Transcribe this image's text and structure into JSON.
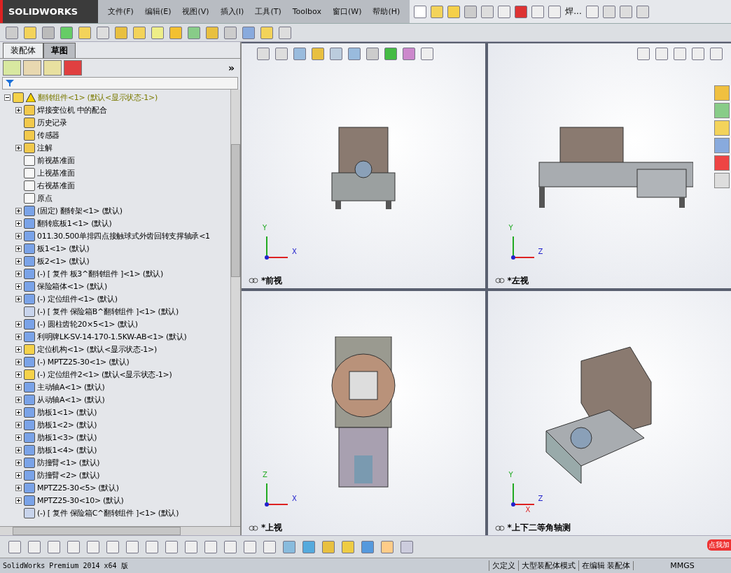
{
  "app": {
    "logo": "SOLIDWORKS",
    "menu": [
      "文件(F)",
      "编辑(E)",
      "视图(V)",
      "插入(I)",
      "工具(T)",
      "Toolbox",
      "窗口(W)",
      "帮助(H)"
    ],
    "weld_button": "焊..."
  },
  "panel": {
    "tabs": [
      {
        "label": "装配体",
        "selected": true
      },
      {
        "label": "草图",
        "selected": false
      }
    ],
    "more": "»"
  },
  "tree": {
    "label": "翻转组件<1> (默认<显示状态-1>)",
    "expanded": true,
    "warning": true,
    "children": [
      {
        "label": "焊接变位机 中的配合",
        "kind": "mates",
        "collapsed": true
      },
      {
        "label": "历史记录",
        "kind": "history",
        "collapsed": false
      },
      {
        "label": "传感器",
        "kind": "sensor",
        "collapsed": false
      },
      {
        "label": "注解",
        "kind": "annotation",
        "collapsed": true
      },
      {
        "label": "前视基准面",
        "kind": "plane",
        "collapsed": false
      },
      {
        "label": "上视基准面",
        "kind": "plane",
        "collapsed": false
      },
      {
        "label": "右视基准面",
        "kind": "plane",
        "collapsed": false
      },
      {
        "label": "原点",
        "kind": "origin",
        "collapsed": false
      },
      {
        "label": "(固定) 翻转架<1> (默认)",
        "kind": "part",
        "collapsed": true
      },
      {
        "label": "翻转底板1<1> (默认)",
        "kind": "part",
        "collapsed": true
      },
      {
        "label": "011.30.500单排四点接触球式外齿回转支撑轴承<1",
        "kind": "part",
        "collapsed": true
      },
      {
        "label": "板1<1> (默认)",
        "kind": "part",
        "collapsed": true
      },
      {
        "label": "板2<1> (默认)",
        "kind": "part",
        "collapsed": true
      },
      {
        "label": "(-) [ 复件 板3^翻转组件 ]<1> (默认)",
        "kind": "part",
        "collapsed": true
      },
      {
        "label": "保险箱体<1> (默认)",
        "kind": "part",
        "collapsed": true
      },
      {
        "label": "(-) 定位组件<1> (默认)",
        "kind": "part",
        "collapsed": true
      },
      {
        "label": "(-) [ 复件 保险箱B^翻转组件 ]<1> (默认)",
        "kind": "virtual",
        "collapsed": false
      },
      {
        "label": "(-) 圆柱齿轮20×5<1> (默认)",
        "kind": "part",
        "collapsed": true
      },
      {
        "label": "利明牌LK-SV-14-170-1.5KW-AB<1> (默认)",
        "kind": "part",
        "collapsed": true
      },
      {
        "label": "定位机构<1> (默认<显示状态-1>)",
        "kind": "assembly",
        "collapsed": true
      },
      {
        "label": "(-) MPTZ25-30<1> (默认)",
        "kind": "part",
        "collapsed": true
      },
      {
        "label": "(-) 定位组件2<1> (默认<显示状态-1>)",
        "kind": "assembly",
        "collapsed": true
      },
      {
        "label": "主动轴A<1> (默认)",
        "kind": "part",
        "collapsed": true
      },
      {
        "label": "从动轴A<1> (默认)",
        "kind": "part",
        "collapsed": true
      },
      {
        "label": "肋板1<1> (默认)",
        "kind": "part",
        "collapsed": true
      },
      {
        "label": "肋板1<2> (默认)",
        "kind": "part",
        "collapsed": true
      },
      {
        "label": "肋板1<3> (默认)",
        "kind": "part",
        "collapsed": true
      },
      {
        "label": "肋板1<4> (默认)",
        "kind": "part",
        "collapsed": true
      },
      {
        "label": "防撞臂<1> (默认)",
        "kind": "part",
        "collapsed": true
      },
      {
        "label": "防撞臂<2> (默认)",
        "kind": "part",
        "collapsed": true
      },
      {
        "label": "MPTZ25-30<5> (默认)",
        "kind": "part",
        "collapsed": true
      },
      {
        "label": "MPTZ25-30<10> (默认)",
        "kind": "part",
        "collapsed": true
      },
      {
        "label": "(-) [ 复件 保险箱C^翻转组件 ]<1> (默认)",
        "kind": "virtual",
        "collapsed": false
      }
    ]
  },
  "viewports": [
    {
      "label": "*前视",
      "kind": "front",
      "axes": [
        "Y",
        "X"
      ]
    },
    {
      "label": "*左视",
      "kind": "left",
      "axes": [
        "Y",
        "Z"
      ]
    },
    {
      "label": "*上视",
      "kind": "top",
      "axes": [
        "Z",
        "X"
      ]
    },
    {
      "label": "*上下二等角轴测",
      "kind": "iso",
      "axes": [
        "Y",
        "Z",
        "X"
      ]
    }
  ],
  "promo": "点我加",
  "status_bar": [
    "SolidWorks Premium 2014 x64 版",
    "欠定义",
    "大型装配体模式",
    "在编辑 装配体",
    "MMGS"
  ]
}
